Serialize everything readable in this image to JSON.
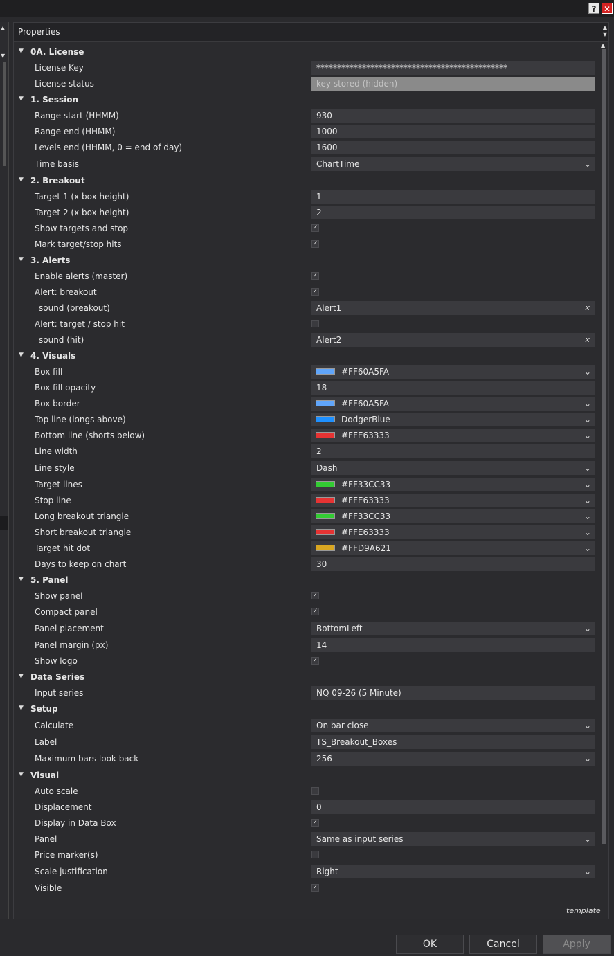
{
  "window": {
    "help_label": "?",
    "close_label": "✕"
  },
  "panel": {
    "title": "Properties",
    "footer_link": "template"
  },
  "rows": [
    {
      "type": "cat",
      "label": "0A. License"
    },
    {
      "type": "text",
      "label": "License Key",
      "value": "**********************************************"
    },
    {
      "type": "readonly",
      "label": "License status",
      "value": "key stored (hidden)"
    },
    {
      "type": "cat",
      "label": "1. Session"
    },
    {
      "type": "text",
      "label": "Range start (HHMM)",
      "value": "930"
    },
    {
      "type": "text",
      "label": "Range end (HHMM)",
      "value": "1000"
    },
    {
      "type": "text",
      "label": "Levels end (HHMM, 0 = end of day)",
      "value": "1600"
    },
    {
      "type": "select",
      "label": "Time basis",
      "value": "ChartTime"
    },
    {
      "type": "cat",
      "label": "2. Breakout"
    },
    {
      "type": "text",
      "label": "Target 1 (x box height)",
      "value": "1"
    },
    {
      "type": "text",
      "label": "Target 2 (x box height)",
      "value": "2"
    },
    {
      "type": "check",
      "label": "Show targets and stop",
      "checked": true
    },
    {
      "type": "check",
      "label": "Mark target/stop hits",
      "checked": true
    },
    {
      "type": "cat",
      "label": "3. Alerts"
    },
    {
      "type": "check",
      "label": "Enable alerts (master)",
      "checked": true
    },
    {
      "type": "check",
      "label": "Alert: breakout",
      "checked": true
    },
    {
      "type": "sound",
      "label": "sound (breakout)",
      "value": "Alert1",
      "clear": "x",
      "sub": true
    },
    {
      "type": "check",
      "label": "Alert: target / stop hit",
      "checked": false
    },
    {
      "type": "sound",
      "label": "sound (hit)",
      "value": "Alert2",
      "clear": "x",
      "sub": true
    },
    {
      "type": "cat",
      "label": "4. Visuals"
    },
    {
      "type": "color",
      "label": "Box fill",
      "value": "#FF60A5FA",
      "swatch": "#60A5FA"
    },
    {
      "type": "text",
      "label": "Box fill opacity",
      "value": "18"
    },
    {
      "type": "color",
      "label": "Box border",
      "value": "#FF60A5FA",
      "swatch": "#60A5FA"
    },
    {
      "type": "color",
      "label": "Top line (longs above)",
      "value": "DodgerBlue",
      "swatch": "#1E90FF"
    },
    {
      "type": "color",
      "label": "Bottom line (shorts below)",
      "value": "#FFE63333",
      "swatch": "#E63333"
    },
    {
      "type": "text",
      "label": "Line width",
      "value": "2"
    },
    {
      "type": "select",
      "label": "Line style",
      "value": "Dash"
    },
    {
      "type": "color",
      "label": "Target lines",
      "value": "#FF33CC33",
      "swatch": "#33CC33"
    },
    {
      "type": "color",
      "label": "Stop line",
      "value": "#FFE63333",
      "swatch": "#E63333"
    },
    {
      "type": "color",
      "label": "Long breakout triangle",
      "value": "#FF33CC33",
      "swatch": "#33CC33"
    },
    {
      "type": "color",
      "label": "Short breakout triangle",
      "value": "#FFE63333",
      "swatch": "#E63333"
    },
    {
      "type": "color",
      "label": "Target hit dot",
      "value": "#FFD9A621",
      "swatch": "#D9A621"
    },
    {
      "type": "text",
      "label": "Days to keep on chart",
      "value": "30"
    },
    {
      "type": "cat",
      "label": "5. Panel"
    },
    {
      "type": "check",
      "label": "Show panel",
      "checked": true
    },
    {
      "type": "check",
      "label": "Compact panel",
      "checked": true
    },
    {
      "type": "select",
      "label": "Panel placement",
      "value": "BottomLeft"
    },
    {
      "type": "text",
      "label": "Panel margin (px)",
      "value": "14"
    },
    {
      "type": "check",
      "label": "Show logo",
      "checked": true
    },
    {
      "type": "cat",
      "label": "Data Series"
    },
    {
      "type": "text",
      "label": "Input series",
      "value": "NQ 09-26 (5 Minute)"
    },
    {
      "type": "cat",
      "label": "Setup"
    },
    {
      "type": "select",
      "label": "Calculate",
      "value": "On bar close"
    },
    {
      "type": "text",
      "label": "Label",
      "value": "TS_Breakout_Boxes"
    },
    {
      "type": "select",
      "label": "Maximum bars look back",
      "value": "256"
    },
    {
      "type": "cat",
      "label": "Visual"
    },
    {
      "type": "check",
      "label": "Auto scale",
      "checked": false
    },
    {
      "type": "text",
      "label": "Displacement",
      "value": "0"
    },
    {
      "type": "check",
      "label": "Display in Data Box",
      "checked": true
    },
    {
      "type": "select",
      "label": "Panel",
      "value": "Same as input series"
    },
    {
      "type": "check",
      "label": "Price marker(s)",
      "checked": false
    },
    {
      "type": "select",
      "label": "Scale justification",
      "value": "Right"
    },
    {
      "type": "check",
      "label": "Visible",
      "checked": true
    }
  ],
  "buttons": {
    "ok": "OK",
    "cancel": "Cancel",
    "apply": "Apply"
  }
}
